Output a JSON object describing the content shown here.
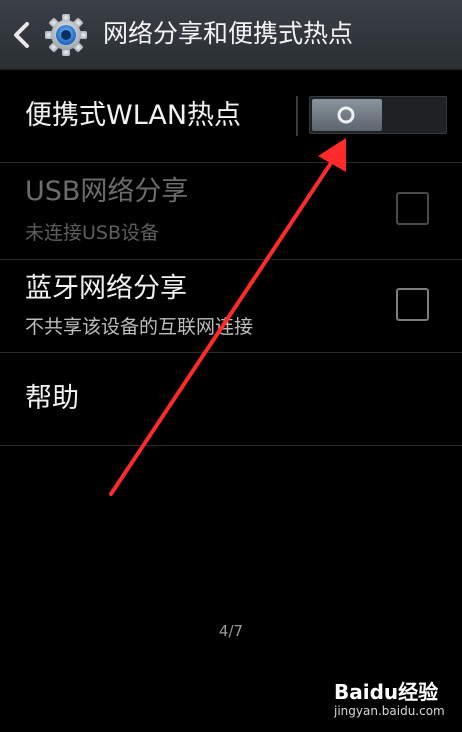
{
  "action_bar": {
    "title": "网络分享和便携式热点",
    "back_icon": "chevron-left-icon",
    "app_icon": "gear-icon"
  },
  "hotspot": {
    "label": "便携式WLAN热点",
    "toggle_state": "off"
  },
  "usb_tethering": {
    "title": "USB网络分享",
    "summary": "未连接USB设备",
    "checked": false,
    "enabled": false
  },
  "bluetooth_tethering": {
    "title": "蓝牙网络分享",
    "summary": "不共享该设备的互联网连接",
    "checked": false,
    "enabled": true
  },
  "help": {
    "label": "帮助"
  },
  "page_indicator": "4/7",
  "watermark": {
    "brand": "Baidu经验",
    "url": "jingyan.baidu.com"
  },
  "colors": {
    "action_bar": "#2f3439",
    "background": "#000000",
    "annotation_arrow": "#ff2a2a"
  }
}
